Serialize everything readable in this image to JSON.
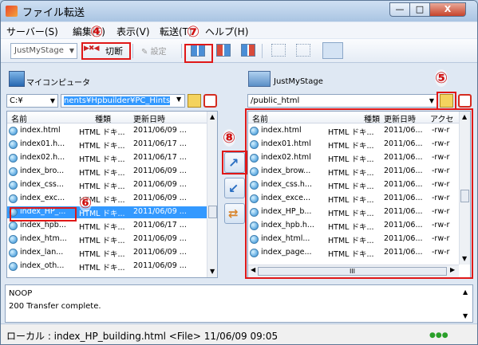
{
  "window": {
    "title": "ファイル転送",
    "minimize": "—",
    "maximize": "□",
    "close": "X"
  },
  "menu": [
    "サーバー(S)",
    "編集(E)",
    "表示(V)",
    "転送(T)",
    "ヘルプ(H)"
  ],
  "toolbar": {
    "site_select": "JustMyStage",
    "disconnect": "切断",
    "settings": "設定"
  },
  "callouts": {
    "n4": "④",
    "n5": "⑤",
    "n6": "⑥",
    "n7": "⑦",
    "n8": "⑧"
  },
  "local": {
    "label": "マイコンピュータ",
    "drive": "C:¥",
    "path": "nents¥Hpbuilder¥PC_Hints",
    "headers": {
      "name": "名前",
      "type": "種類",
      "date": "更新日時"
    },
    "files": [
      {
        "name": "index.html",
        "type": "HTML ドキ...",
        "date": "2011/06/09 ..."
      },
      {
        "name": "index01.h...",
        "type": "HTML ドキ...",
        "date": "2011/06/17 ..."
      },
      {
        "name": "index02.h...",
        "type": "HTML ドキ...",
        "date": "2011/06/17 ..."
      },
      {
        "name": "index_bro...",
        "type": "HTML ドキ...",
        "date": "2011/06/09 ..."
      },
      {
        "name": "index_css...",
        "type": "HTML ドキ...",
        "date": "2011/06/09 ..."
      },
      {
        "name": "index_exc...",
        "type": "HTML ドキ...",
        "date": "2011/06/09 ..."
      },
      {
        "name": "index_HP_...",
        "type": "HTML ドキ...",
        "date": "2011/06/09 ..."
      },
      {
        "name": "index_hpb...",
        "type": "HTML ドキ...",
        "date": "2011/06/17 ..."
      },
      {
        "name": "index_htm...",
        "type": "HTML ドキ...",
        "date": "2011/06/09 ..."
      },
      {
        "name": "index_lan...",
        "type": "HTML ドキ...",
        "date": "2011/06/09 ..."
      },
      {
        "name": "index_oth...",
        "type": "HTML ドキ...",
        "date": "2011/06/09 ..."
      }
    ]
  },
  "remote": {
    "label": "JustMyStage",
    "path": "/public_html",
    "headers": {
      "name": "名前",
      "type": "種類",
      "date": "更新日時",
      "access": "アクセ"
    },
    "files": [
      {
        "name": "index.html",
        "type": "HTML ドキ...",
        "date": "2011/06...",
        "access": "-rw-r"
      },
      {
        "name": "index01.html",
        "type": "HTML ドキ...",
        "date": "2011/06...",
        "access": "-rw-r"
      },
      {
        "name": "index02.html",
        "type": "HTML ドキ...",
        "date": "2011/06...",
        "access": "-rw-r"
      },
      {
        "name": "index_brow...",
        "type": "HTML ドキ...",
        "date": "2011/06...",
        "access": "-rw-r"
      },
      {
        "name": "index_css.h...",
        "type": "HTML ドキ...",
        "date": "2011/06...",
        "access": "-rw-r"
      },
      {
        "name": "index_exce...",
        "type": "HTML ドキ...",
        "date": "2011/06...",
        "access": "-rw-r"
      },
      {
        "name": "index_HP_b...",
        "type": "HTML ドキ...",
        "date": "2011/06...",
        "access": "-rw-r"
      },
      {
        "name": "index_hpb.h...",
        "type": "HTML ドキ...",
        "date": "2011/06...",
        "access": "-rw-r"
      },
      {
        "name": "index_html...",
        "type": "HTML ドキ...",
        "date": "2011/06...",
        "access": "-rw-r"
      },
      {
        "name": "index_page...",
        "type": "HTML ドキ...",
        "date": "2011/06...",
        "access": "-rw-r"
      }
    ],
    "hscroll_thumb": "III"
  },
  "log": {
    "line1": "NOOP",
    "line2": "200  Transfer complete."
  },
  "status": {
    "text": "ローカル : index_HP_building.html <File> 11/06/09 09:05"
  }
}
